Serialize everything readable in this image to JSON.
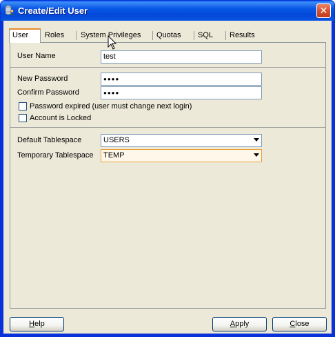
{
  "window": {
    "title": "Create/Edit User",
    "close_glyph": "✕"
  },
  "tabs": [
    "User",
    "Roles",
    "System Privileges",
    "Quotas",
    "SQL",
    "Results"
  ],
  "user": {
    "name_label": "User Name",
    "name_value": "test",
    "new_password_label": "New Password",
    "new_password_value": "●●●●",
    "confirm_password_label": "Confirm Password",
    "confirm_password_value": "●●●●",
    "password_expired_label": "Password expired (user must change next login)",
    "account_locked_label": "Account is Locked",
    "default_tablespace_label": "Default Tablespace",
    "default_tablespace_value": "USERS",
    "temporary_tablespace_label": "Temporary Tablespace",
    "temporary_tablespace_value": "TEMP"
  },
  "buttons": {
    "help_prefix": "",
    "help_mnemonic": "H",
    "help_rest": "elp",
    "apply_prefix": "",
    "apply_mnemonic": "A",
    "apply_rest": "pply",
    "close_prefix": "",
    "close_mnemonic": "C",
    "close_rest": "lose"
  },
  "icons": [
    "database-user-icon",
    "close-icon",
    "dropdown-arrow-icon",
    "mouse-cursor-icon"
  ],
  "colors": {
    "titlebar": "#0856e6",
    "active_tab_accent": "#e68b2c",
    "focus_border": "#e8a03c"
  }
}
